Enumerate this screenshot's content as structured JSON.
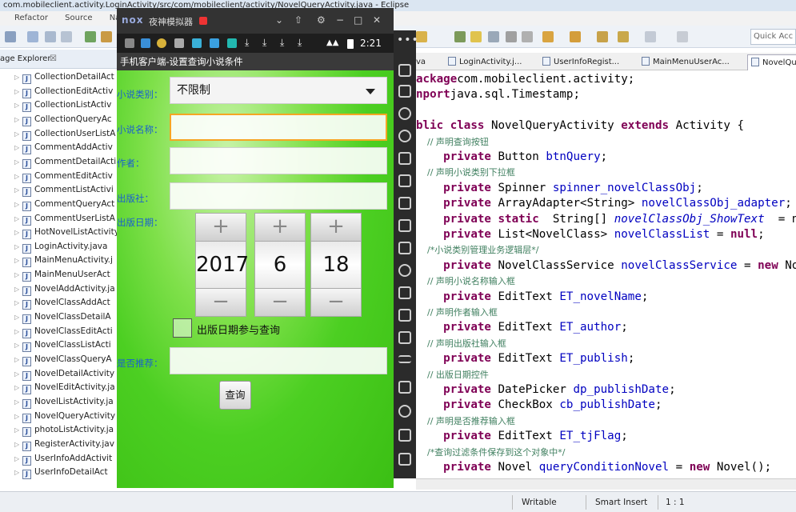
{
  "window": {
    "title": "com.mobileclient.activity.LoginActivity/src/com/mobileclient/activity/NovelQueryActivity.java - Eclipse"
  },
  "menu": {
    "items": [
      "Refactor",
      "Source",
      "Navi"
    ]
  },
  "quick_access": {
    "placeholder": "Quick Acc"
  },
  "package_explorer": {
    "title": "age Explorer",
    "close_glyph": "☒",
    "files": [
      "CollectionDetailAct",
      "CollectionEditActiv",
      "CollectionListActiv",
      "CollectionQueryAc",
      "CollectionUserListA",
      "CommentAddActiv",
      "CommentDetailActi",
      "CommentEditActiv",
      "CommentListActivi",
      "CommentQueryAct",
      "CommentUserListA",
      "HotNovelListActivity",
      "LoginActivity.java",
      "MainMenuActivity.j",
      "MainMenuUserAct",
      "NovelAddActivity.ja",
      "NovelClassAddAct",
      "NovelClassDetailA",
      "NovelClassEditActi",
      "NovelClassListActi",
      "NovelClassQueryA",
      "NovelDetailActivity",
      "NovelEditActivity.ja",
      "NovelListActivity.ja",
      "NovelQueryActivity",
      "photoListActivity.ja",
      "RegisterActivity.jav",
      "UserInfoAddActivit",
      "UserInfoDetailAct"
    ]
  },
  "editor_tabs": [
    {
      "label": "va"
    },
    {
      "label": "LoginActivity.j..."
    },
    {
      "label": "UserInfoRegist..."
    },
    {
      "label": "MainMenuUserAc..."
    },
    {
      "label": "NovelQu"
    }
  ],
  "code_lines": [
    {
      "parts": [
        [
          "kw",
          "ackage"
        ],
        [
          "",
          "com.mobileclient.activity;"
        ]
      ]
    },
    {
      "parts": [
        [
          "kw",
          "nport"
        ],
        [
          "",
          "java.sql.Timestamp;"
        ]
      ]
    },
    {
      "parts": []
    },
    {
      "parts": [
        [
          "kw",
          "blic class"
        ],
        [
          "",
          " NovelQueryActivity "
        ],
        [
          "kw",
          "extends"
        ],
        [
          "",
          " Activity {"
        ]
      ]
    },
    {
      "parts": [
        [
          "cm",
          "    // 声明查询按钮"
        ]
      ]
    },
    {
      "parts": [
        [
          "kw",
          "    private"
        ],
        [
          "",
          " Button "
        ],
        [
          "fld",
          "btnQuery"
        ],
        [
          "",
          ";"
        ]
      ]
    },
    {
      "parts": [
        [
          "cm",
          "    // 声明小说类别下拉框"
        ]
      ]
    },
    {
      "parts": [
        [
          "kw",
          "    private"
        ],
        [
          "",
          " Spinner "
        ],
        [
          "fld",
          "spinner_novelClassObj"
        ],
        [
          "",
          ";"
        ]
      ]
    },
    {
      "parts": [
        [
          "kw",
          "    private"
        ],
        [
          "",
          " ArrayAdapter<String> "
        ],
        [
          "fld",
          "novelClassObj_adapter"
        ],
        [
          "",
          ";"
        ]
      ]
    },
    {
      "parts": [
        [
          "kw",
          "    private static"
        ],
        [
          "",
          "  String[] "
        ],
        [
          "st",
          "novelClassObj_ShowText"
        ],
        [
          "",
          "  = n"
        ]
      ]
    },
    {
      "parts": [
        [
          "kw",
          "    private"
        ],
        [
          "",
          " List<NovelClass> "
        ],
        [
          "fld",
          "novelClassList"
        ],
        [
          "",
          " = "
        ],
        [
          "kw",
          "null"
        ],
        [
          "",
          ";"
        ]
      ]
    },
    {
      "parts": [
        [
          "cm",
          "    /*小说类别管理业务逻辑层*/"
        ]
      ]
    },
    {
      "parts": [
        [
          "kw",
          "    private"
        ],
        [
          "",
          " NovelClassService "
        ],
        [
          "fld",
          "novelClassService"
        ],
        [
          "",
          " = "
        ],
        [
          "kw",
          "new"
        ],
        [
          "",
          " No"
        ]
      ]
    },
    {
      "parts": [
        [
          "cm",
          "    // 声明小说名称输入框"
        ]
      ]
    },
    {
      "parts": [
        [
          "kw",
          "    private"
        ],
        [
          "",
          " EditText "
        ],
        [
          "fld",
          "ET_novelName"
        ],
        [
          "",
          ";"
        ]
      ]
    },
    {
      "parts": [
        [
          "cm",
          "    // 声明作者输入框"
        ]
      ]
    },
    {
      "parts": [
        [
          "kw",
          "    private"
        ],
        [
          "",
          " EditText "
        ],
        [
          "fld",
          "ET_author"
        ],
        [
          "",
          ";"
        ]
      ]
    },
    {
      "parts": [
        [
          "cm",
          "    // 声明出版社输入框"
        ]
      ]
    },
    {
      "parts": [
        [
          "kw",
          "    private"
        ],
        [
          "",
          " EditText "
        ],
        [
          "fld",
          "ET_publish"
        ],
        [
          "",
          ";"
        ]
      ]
    },
    {
      "parts": [
        [
          "cm",
          "    // 出版日期控件"
        ]
      ]
    },
    {
      "parts": [
        [
          "kw",
          "    private"
        ],
        [
          "",
          " DatePicker "
        ],
        [
          "fld",
          "dp_publishDate"
        ],
        [
          "",
          ";"
        ]
      ]
    },
    {
      "parts": [
        [
          "kw",
          "    private"
        ],
        [
          "",
          " CheckBox "
        ],
        [
          "fld",
          "cb_publishDate"
        ],
        [
          "",
          ";"
        ]
      ]
    },
    {
      "parts": [
        [
          "cm",
          "    // 声明是否推荐输入框"
        ]
      ]
    },
    {
      "parts": [
        [
          "kw",
          "    private"
        ],
        [
          "",
          " EditText "
        ],
        [
          "fld",
          "ET_tjFlag"
        ],
        [
          "",
          ";"
        ]
      ]
    },
    {
      "parts": [
        [
          "cm",
          "    /*查询过滤条件保存到这个对象中*/"
        ]
      ]
    },
    {
      "parts": [
        [
          "kw",
          "    private"
        ],
        [
          "",
          " Novel "
        ],
        [
          "fld",
          "queryConditionNovel"
        ],
        [
          "",
          " = "
        ],
        [
          "kw",
          "new"
        ],
        [
          "",
          " Novel();"
        ]
      ]
    }
  ],
  "status_bar": {
    "mode": "Writable",
    "insert": "Smart Insert",
    "position": "1 : 1"
  },
  "emulator": {
    "logo": "nox",
    "name": "夜神模拟器",
    "time": "2:21",
    "app_title": "手机客户端-设置查询小说条件",
    "fields": {
      "category_label": "小说类别：",
      "category_value": "不限制",
      "name_label": "小说名称：",
      "author_label": "作者：",
      "publisher_label": "出版社：",
      "date_label": "出版日期：",
      "recommend_label": "是否推荐："
    },
    "date_picker": {
      "year": "2017",
      "month": "6",
      "day": "18",
      "plus": "+",
      "minus": "−"
    },
    "checkbox_label": "出版日期参与查询",
    "query_button": "查询"
  }
}
